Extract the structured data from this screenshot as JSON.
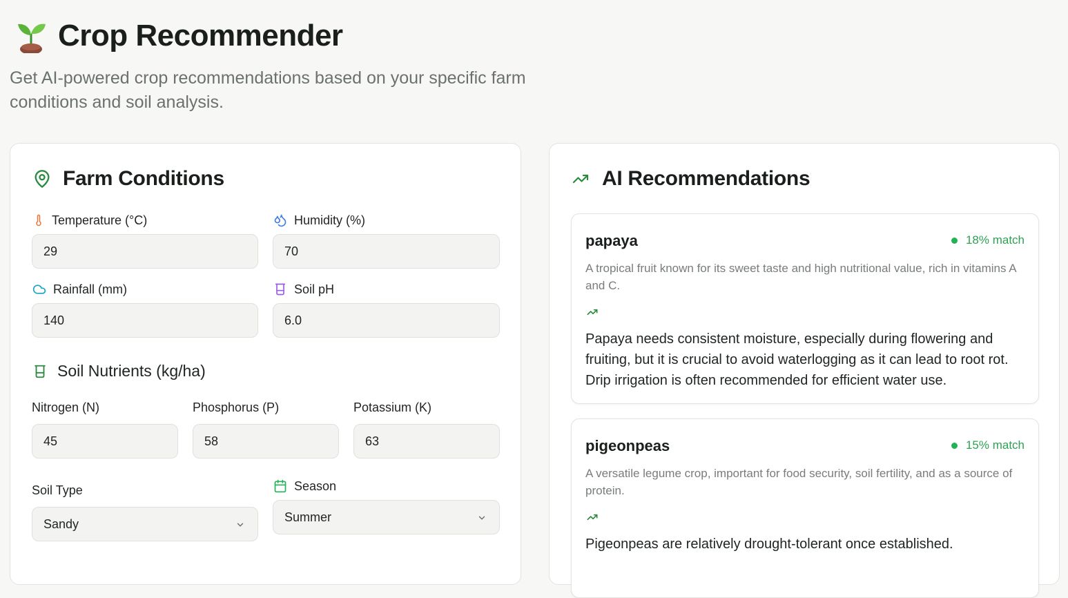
{
  "header": {
    "title": "Crop Recommender",
    "subtitle": "Get AI-powered crop recommendations based on your specific farm conditions and soil analysis."
  },
  "farm_conditions": {
    "title": "Farm Conditions",
    "temperature": {
      "label": "Temperature (°C)",
      "value": "29"
    },
    "humidity": {
      "label": "Humidity (%)",
      "value": "70"
    },
    "rainfall": {
      "label": "Rainfall (mm)",
      "value": "140"
    },
    "soil_ph": {
      "label": "Soil pH",
      "value": "6.0"
    },
    "nutrients_title": "Soil Nutrients (kg/ha)",
    "nitrogen": {
      "label": "Nitrogen (N)",
      "value": "45"
    },
    "phosphorus": {
      "label": "Phosphorus (P)",
      "value": "58"
    },
    "potassium": {
      "label": "Potassium (K)",
      "value": "63"
    },
    "soil_type": {
      "label": "Soil Type",
      "value": "Sandy"
    },
    "season": {
      "label": "Season",
      "value": "Summer"
    }
  },
  "recommendations": {
    "title": "AI Recommendations",
    "items": [
      {
        "name": "papaya",
        "match": "18% match",
        "description": "A tropical fruit known for its sweet taste and high nutritional value, rich in vitamins A and C.",
        "detail": "Papaya needs consistent moisture, especially during flowering and fruiting, but it is crucial to avoid waterlogging as it can lead to root rot. Drip irrigation is often recommended for efficient water use."
      },
      {
        "name": "pigeonpeas",
        "match": "15% match",
        "description": "A versatile legume crop, important for food security, soil fertility, and as a source of protein.",
        "detail": "Pigeonpeas are relatively drought-tolerant once established."
      }
    ]
  },
  "colors": {
    "accent_green": "#2ea153",
    "icon_orange": "#e8773a",
    "icon_blue": "#3f7fe0",
    "icon_cyan": "#17a3c4",
    "icon_purple": "#9b5de5"
  }
}
